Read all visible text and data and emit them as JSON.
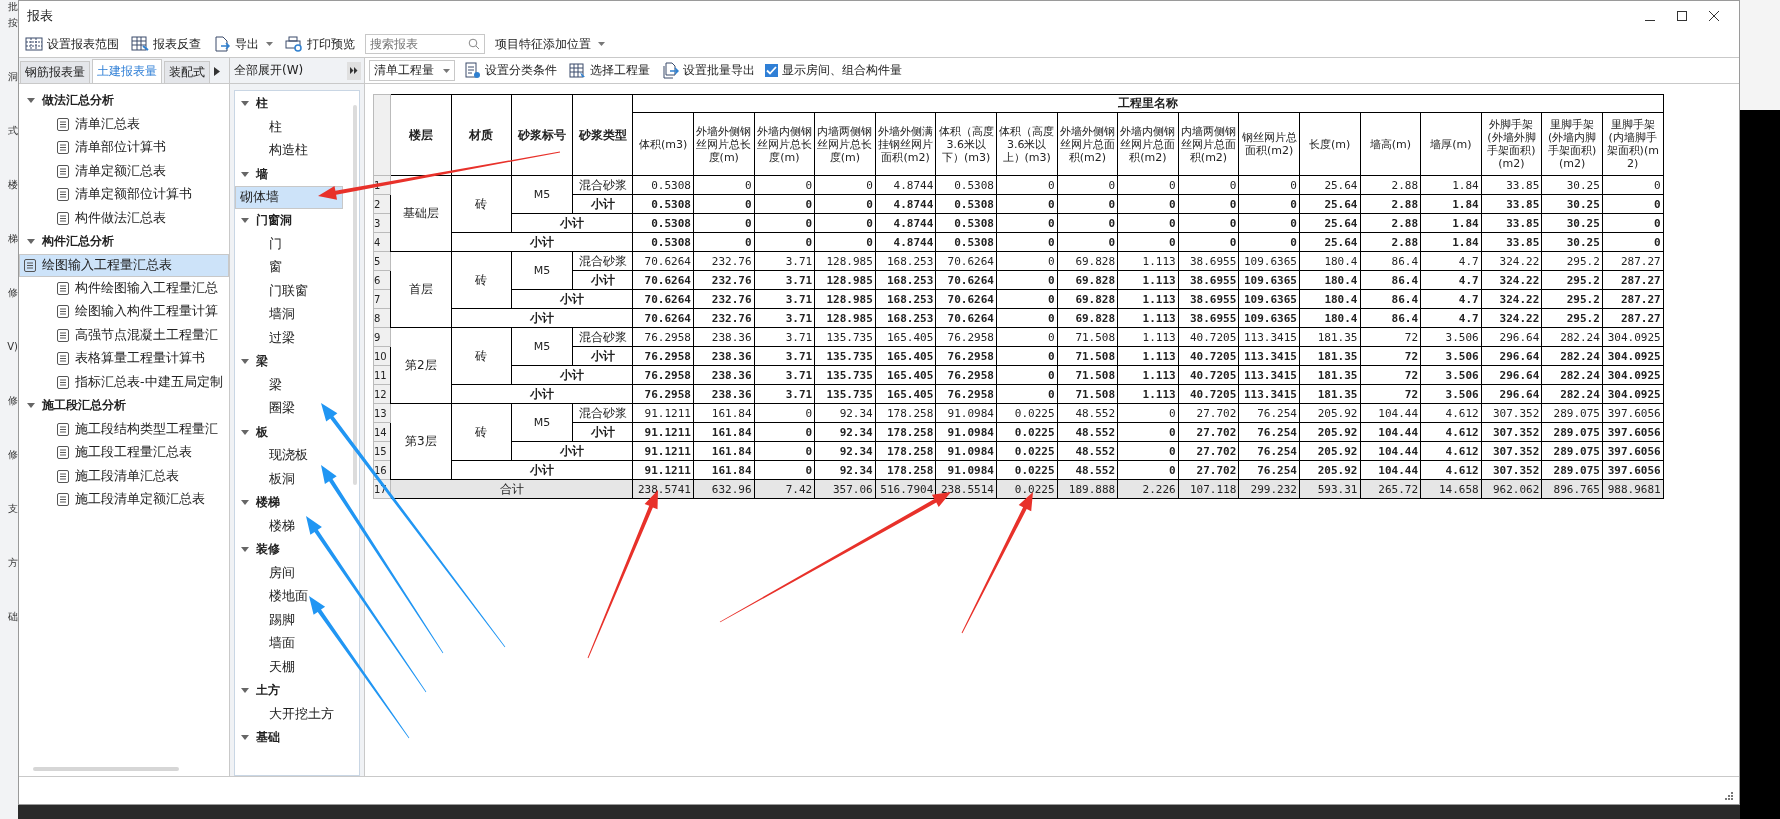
{
  "background_app": {
    "items": [
      "批",
      "按",
      "洞",
      "式",
      "楼",
      "梯",
      "修",
      "V)",
      "修",
      "修",
      "支",
      "方",
      "础"
    ]
  },
  "window": {
    "title": "报表"
  },
  "toolbar": {
    "buttons": [
      {
        "label": "设置报表范围",
        "kind": "range",
        "dropdown": false
      },
      {
        "label": "报表反查",
        "kind": "lookup",
        "dropdown": false
      },
      {
        "label": "导出",
        "kind": "export",
        "dropdown": true
      },
      {
        "label": "打印预览",
        "kind": "print",
        "dropdown": false
      }
    ],
    "search": {
      "placeholder": "搜索报表"
    },
    "position_menu": {
      "label": "项目特征添加位置"
    }
  },
  "left_panel": {
    "tabs": [
      {
        "label": "钢筋报表量",
        "selected": false
      },
      {
        "label": "土建报表量",
        "selected": true
      },
      {
        "label": "装配式",
        "selected": false
      }
    ],
    "tree": [
      {
        "label": "做法汇总分析",
        "expanded": true,
        "children": [
          {
            "label": "清单汇总表",
            "selected": false
          },
          {
            "label": "清单部位计算书",
            "selected": false
          },
          {
            "label": "清单定额汇总表",
            "selected": false
          },
          {
            "label": "清单定额部位计算书",
            "selected": false
          },
          {
            "label": "构件做法汇总表",
            "selected": false
          }
        ]
      },
      {
        "label": "构件汇总分析",
        "expanded": true,
        "children": [
          {
            "label": "绘图输入工程量汇总表",
            "selected": true
          },
          {
            "label": "构件绘图输入工程量汇总",
            "selected": false
          },
          {
            "label": "绘图输入构件工程量计算",
            "selected": false
          },
          {
            "label": "高强节点混凝土工程量汇",
            "selected": false
          },
          {
            "label": "表格算量工程量计算书",
            "selected": false
          },
          {
            "label": "指标汇总表-中建五局定制",
            "selected": false
          }
        ]
      },
      {
        "label": "施工段汇总分析",
        "expanded": true,
        "children": [
          {
            "label": "施工段结构类型工程量汇",
            "selected": false
          },
          {
            "label": "施工段工程量汇总表",
            "selected": false
          },
          {
            "label": "施工段清单汇总表",
            "selected": false
          },
          {
            "label": "施工段清单定额汇总表",
            "selected": false
          }
        ]
      }
    ]
  },
  "component_panel": {
    "expand_all": "全部展开(W)",
    "tree": [
      {
        "label": "柱",
        "expanded": true,
        "children": [
          {
            "label": "柱",
            "selected": false
          },
          {
            "label": "构造柱",
            "selected": false
          }
        ]
      },
      {
        "label": "墙",
        "expanded": true,
        "children": [
          {
            "label": "砌体墙",
            "selected": true
          }
        ]
      },
      {
        "label": "门窗洞",
        "expanded": true,
        "children": [
          {
            "label": "门",
            "selected": false
          },
          {
            "label": "窗",
            "selected": false
          },
          {
            "label": "门联窗",
            "selected": false
          },
          {
            "label": "墙洞",
            "selected": false
          },
          {
            "label": "过梁",
            "selected": false
          }
        ]
      },
      {
        "label": "梁",
        "expanded": true,
        "children": [
          {
            "label": "梁",
            "selected": false
          },
          {
            "label": "圈梁",
            "selected": false
          }
        ]
      },
      {
        "label": "板",
        "expanded": true,
        "children": [
          {
            "label": "现浇板",
            "selected": false
          },
          {
            "label": "板洞",
            "selected": false
          }
        ]
      },
      {
        "label": "楼梯",
        "expanded": true,
        "children": [
          {
            "label": "楼梯",
            "selected": false
          }
        ]
      },
      {
        "label": "装修",
        "expanded": true,
        "children": [
          {
            "label": "房间",
            "selected": false
          },
          {
            "label": "楼地面",
            "selected": false
          },
          {
            "label": "踢脚",
            "selected": false
          },
          {
            "label": "墙面",
            "selected": false
          },
          {
            "label": "天棚",
            "selected": false
          }
        ]
      },
      {
        "label": "土方",
        "expanded": true,
        "children": [
          {
            "label": "大开挖土方",
            "selected": false
          }
        ]
      },
      {
        "label": "基础",
        "expanded": true
      }
    ]
  },
  "report_toolbar": {
    "quantity_select": "清单工程量",
    "buttons": [
      {
        "label": "设置分类条件",
        "kind": "conditions"
      },
      {
        "label": "选择工程量",
        "kind": "select"
      },
      {
        "label": "设置批量导出",
        "kind": "batch"
      }
    ],
    "show_rooms": {
      "label": "显示房间、组合构件量",
      "checked": true
    }
  },
  "table": {
    "fixed_columns": [
      "楼层",
      "材质",
      "砂浆标号",
      "砂浆类型"
    ],
    "group_title": "工程里名称",
    "columns": [
      "体积(m3)",
      "外墙外侧钢丝网片总长度(m)",
      "外墙内侧钢丝网片总长度(m)",
      "内墙两侧钢丝网片总长度(m)",
      "外墙外侧满挂钢丝网片面积(m2)",
      "体积（高度3.6米以下）(m3)",
      "体积（高度3.6米以上）(m3)",
      "外墙外侧钢丝网片总面积(m2)",
      "外墙内侧钢丝网片总面积(m2)",
      "内墙两侧钢丝网片总面积(m2)",
      "钢丝网片总面积(m2)",
      "长度(m)",
      "墙高(m)",
      "墙厚(m)",
      "外脚手架(外墙外脚手架面积)(m2)",
      "里脚手架(外墙内脚手架面积)(m2)",
      "里脚手架(内墙脚手架面积)(m2)"
    ],
    "rows": [
      {
        "number": "1",
        "kind": "detail",
        "floor": "基础层",
        "material": "砖",
        "grade": "M5",
        "mortar_type": "混合砂浆",
        "values": [
          "0.5308",
          "0",
          "0",
          "0",
          "4.8744",
          "0.5308",
          "0",
          "0",
          "0",
          "0",
          "0",
          "25.64",
          "2.88",
          "1.84",
          "33.85",
          "30.25",
          "0"
        ]
      },
      {
        "number": "2",
        "kind": "subtotal_type",
        "label": "小计",
        "values": [
          "0.5308",
          "0",
          "0",
          "0",
          "4.8744",
          "0.5308",
          "0",
          "0",
          "0",
          "0",
          "0",
          "25.64",
          "2.88",
          "1.84",
          "33.85",
          "30.25",
          "0"
        ]
      },
      {
        "number": "3",
        "kind": "subtotal_grade",
        "label": "小计",
        "values": [
          "0.5308",
          "0",
          "0",
          "0",
          "4.8744",
          "0.5308",
          "0",
          "0",
          "0",
          "0",
          "0",
          "25.64",
          "2.88",
          "1.84",
          "33.85",
          "30.25",
          "0"
        ]
      },
      {
        "number": "4",
        "kind": "subtotal_floor",
        "label": "小计",
        "values": [
          "0.5308",
          "0",
          "0",
          "0",
          "4.8744",
          "0.5308",
          "0",
          "0",
          "0",
          "0",
          "0",
          "25.64",
          "2.88",
          "1.84",
          "33.85",
          "30.25",
          "0"
        ]
      },
      {
        "number": "5",
        "kind": "detail",
        "floor": "首层",
        "material": "砖",
        "grade": "M5",
        "mortar_type": "混合砂浆",
        "values": [
          "70.6264",
          "232.76",
          "3.71",
          "128.985",
          "168.253",
          "70.6264",
          "0",
          "69.828",
          "1.113",
          "38.6955",
          "109.6365",
          "180.4",
          "86.4",
          "4.7",
          "324.22",
          "295.2",
          "287.27"
        ]
      },
      {
        "number": "6",
        "kind": "subtotal_type",
        "label": "小计",
        "values": [
          "70.6264",
          "232.76",
          "3.71",
          "128.985",
          "168.253",
          "70.6264",
          "0",
          "69.828",
          "1.113",
          "38.6955",
          "109.6365",
          "180.4",
          "86.4",
          "4.7",
          "324.22",
          "295.2",
          "287.27"
        ]
      },
      {
        "number": "7",
        "kind": "subtotal_grade",
        "label": "小计",
        "values": [
          "70.6264",
          "232.76",
          "3.71",
          "128.985",
          "168.253",
          "70.6264",
          "0",
          "69.828",
          "1.113",
          "38.6955",
          "109.6365",
          "180.4",
          "86.4",
          "4.7",
          "324.22",
          "295.2",
          "287.27"
        ]
      },
      {
        "number": "8",
        "kind": "subtotal_floor",
        "label": "小计",
        "values": [
          "70.6264",
          "232.76",
          "3.71",
          "128.985",
          "168.253",
          "70.6264",
          "0",
          "69.828",
          "1.113",
          "38.6955",
          "109.6365",
          "180.4",
          "86.4",
          "4.7",
          "324.22",
          "295.2",
          "287.27"
        ]
      },
      {
        "number": "9",
        "kind": "detail",
        "floor": "第2层",
        "material": "砖",
        "grade": "M5",
        "mortar_type": "混合砂浆",
        "values": [
          "76.2958",
          "238.36",
          "3.71",
          "135.735",
          "165.405",
          "76.2958",
          "0",
          "71.508",
          "1.113",
          "40.7205",
          "113.3415",
          "181.35",
          "72",
          "3.506",
          "296.64",
          "282.24",
          "304.0925"
        ]
      },
      {
        "number": "10",
        "kind": "subtotal_type",
        "label": "小计",
        "values": [
          "76.2958",
          "238.36",
          "3.71",
          "135.735",
          "165.405",
          "76.2958",
          "0",
          "71.508",
          "1.113",
          "40.7205",
          "113.3415",
          "181.35",
          "72",
          "3.506",
          "296.64",
          "282.24",
          "304.0925"
        ]
      },
      {
        "number": "11",
        "kind": "subtotal_grade",
        "label": "小计",
        "values": [
          "76.2958",
          "238.36",
          "3.71",
          "135.735",
          "165.405",
          "76.2958",
          "0",
          "71.508",
          "1.113",
          "40.7205",
          "113.3415",
          "181.35",
          "72",
          "3.506",
          "296.64",
          "282.24",
          "304.0925"
        ]
      },
      {
        "number": "12",
        "kind": "subtotal_floor",
        "label": "小计",
        "values": [
          "76.2958",
          "238.36",
          "3.71",
          "135.735",
          "165.405",
          "76.2958",
          "0",
          "71.508",
          "1.113",
          "40.7205",
          "113.3415",
          "181.35",
          "72",
          "3.506",
          "296.64",
          "282.24",
          "304.0925"
        ]
      },
      {
        "number": "13",
        "kind": "detail",
        "floor": "第3层",
        "material": "砖",
        "grade": "M5",
        "mortar_type": "混合砂浆",
        "values": [
          "91.1211",
          "161.84",
          "0",
          "92.34",
          "178.258",
          "91.0984",
          "0.0225",
          "48.552",
          "0",
          "27.702",
          "76.254",
          "205.92",
          "104.44",
          "4.612",
          "307.352",
          "289.075",
          "397.6056"
        ]
      },
      {
        "number": "14",
        "kind": "subtotal_type",
        "label": "小计",
        "values": [
          "91.1211",
          "161.84",
          "0",
          "92.34",
          "178.258",
          "91.0984",
          "0.0225",
          "48.552",
          "0",
          "27.702",
          "76.254",
          "205.92",
          "104.44",
          "4.612",
          "307.352",
          "289.075",
          "397.6056"
        ]
      },
      {
        "number": "15",
        "kind": "subtotal_grade",
        "label": "小计",
        "values": [
          "91.1211",
          "161.84",
          "0",
          "92.34",
          "178.258",
          "91.0984",
          "0.0225",
          "48.552",
          "0",
          "27.702",
          "76.254",
          "205.92",
          "104.44",
          "4.612",
          "307.352",
          "289.075",
          "397.6056"
        ]
      },
      {
        "number": "16",
        "kind": "subtotal_floor",
        "label": "小计",
        "values": [
          "91.1211",
          "161.84",
          "0",
          "92.34",
          "178.258",
          "91.0984",
          "0.0225",
          "48.552",
          "0",
          "27.702",
          "76.254",
          "205.92",
          "104.44",
          "4.612",
          "307.352",
          "289.075",
          "397.6056"
        ]
      },
      {
        "number": "17",
        "kind": "total",
        "label": "合计",
        "values": [
          "238.5741",
          "632.96",
          "7.42",
          "357.06",
          "516.7904",
          "238.5514",
          "0.0225",
          "189.888",
          "2.226",
          "107.118",
          "299.232",
          "593.31",
          "265.72",
          "14.658",
          "962.062",
          "896.765",
          "988.9681"
        ]
      }
    ]
  }
}
